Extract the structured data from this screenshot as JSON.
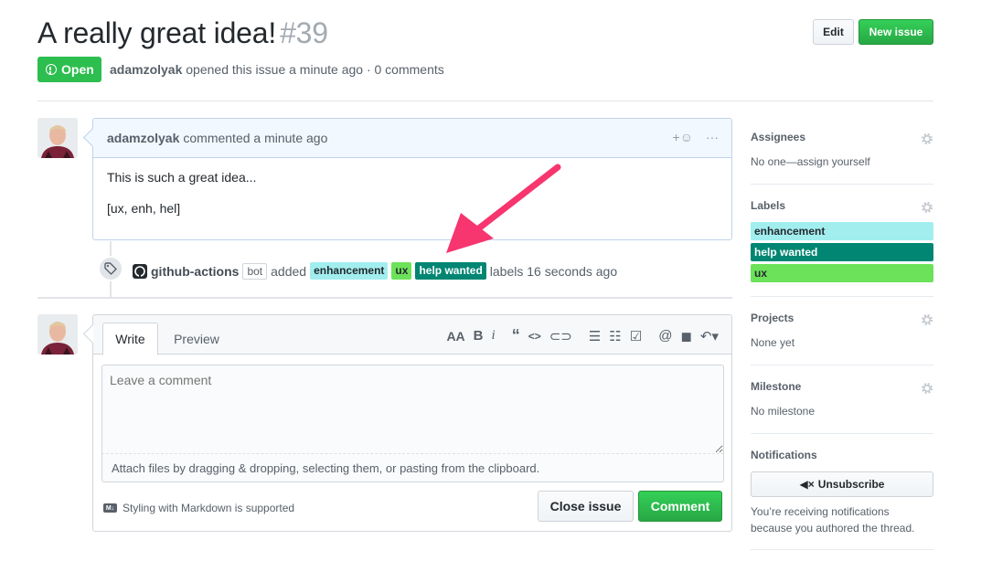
{
  "issue": {
    "title": "A really great idea!",
    "number": "#39",
    "state": "Open",
    "author": "adamzolyak",
    "meta_text": "opened this issue a minute ago · 0 comments"
  },
  "header_buttons": {
    "edit": "Edit",
    "new_issue": "New issue"
  },
  "comment": {
    "author": "adamzolyak",
    "meta": "commented a minute ago",
    "reaction_icon": "+☺",
    "more_icon": "···",
    "body_line1": "This is such a great idea...",
    "body_line2": "[ux, enh, hel]"
  },
  "event": {
    "actor": "github-actions",
    "bot_tag": "bot",
    "verb": "added",
    "labels": [
      "enhancement",
      "ux",
      "help wanted"
    ],
    "suffix": "labels 16 seconds ago"
  },
  "form": {
    "tab_write": "Write",
    "tab_preview": "Preview",
    "placeholder": "Leave a comment",
    "attach_hint": "Attach files by dragging & dropping, selecting them, or pasting from the clipboard.",
    "markdown_hint": "Styling with Markdown is supported",
    "md_badge": "M↓",
    "close_issue": "Close issue",
    "comment": "Comment"
  },
  "sidebar": {
    "assignees": {
      "heading": "Assignees",
      "value": "No one—assign yourself"
    },
    "labels": {
      "heading": "Labels",
      "items": [
        "enhancement",
        "help wanted",
        "ux"
      ]
    },
    "projects": {
      "heading": "Projects",
      "value": "None yet"
    },
    "milestone": {
      "heading": "Milestone",
      "value": "No milestone"
    },
    "notifications": {
      "heading": "Notifications",
      "button": "Unsubscribe",
      "note_line1": "You’re receiving notifications",
      "note_line2": "because you authored the thread."
    }
  },
  "colors": {
    "enhancement": "#a2eeef",
    "help_wanted": "#008672",
    "ux": "#6ce25a",
    "open_state": "#2cbe4e",
    "annotation_arrow": "#f7356f"
  }
}
